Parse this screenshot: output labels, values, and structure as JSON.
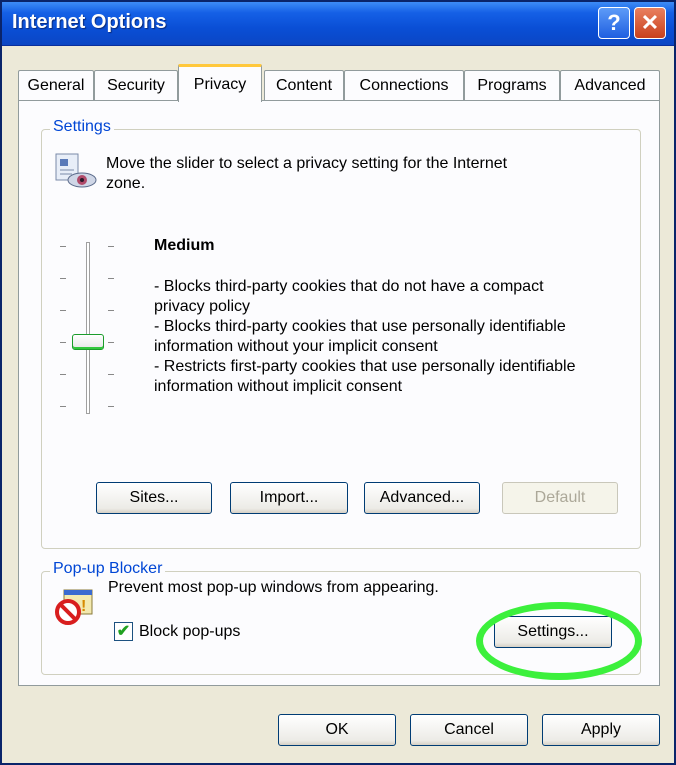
{
  "window": {
    "title": "Internet Options"
  },
  "titlebar": {
    "help_glyph": "?",
    "close_glyph": "✕"
  },
  "tabs": [
    {
      "label": "General"
    },
    {
      "label": "Security"
    },
    {
      "label": "Privacy"
    },
    {
      "label": "Content"
    },
    {
      "label": "Connections"
    },
    {
      "label": "Programs"
    },
    {
      "label": "Advanced"
    }
  ],
  "active_tab": "Privacy",
  "settings": {
    "legend": "Settings",
    "intro_line1": "Move the slider to select a privacy setting for the Internet",
    "intro_line2": "zone.",
    "level_title": "Medium",
    "slider_level": "Medium",
    "description": [
      "- Blocks third-party cookies that do not have a compact",
      "privacy policy",
      "- Blocks third-party cookies that use personally identifiable",
      "information without your implicit consent",
      "- Restricts first-party cookies that use personally identifiable",
      "information without implicit consent"
    ],
    "buttons": {
      "sites": "Sites...",
      "import": "Import...",
      "advanced": "Advanced...",
      "default": "Default"
    }
  },
  "popup": {
    "legend": "Pop-up Blocker",
    "description": "Prevent most pop-up windows from appearing.",
    "checkbox_label": "Block pop-ups",
    "checkbox_checked": true,
    "settings_button": "Settings..."
  },
  "footer": {
    "ok": "OK",
    "cancel": "Cancel",
    "apply": "Apply"
  },
  "colors": {
    "titlebar": "#0a4fd6",
    "window_bg": "#ece9d8",
    "legend_text": "#0046d5",
    "highlight_ring": "#3cf03c",
    "close_button": "#c8401d"
  },
  "icons": {
    "privacy": "privacy-zone-icon",
    "popup": "popup-blocker-icon",
    "slider_thumb": "slider-thumb"
  }
}
